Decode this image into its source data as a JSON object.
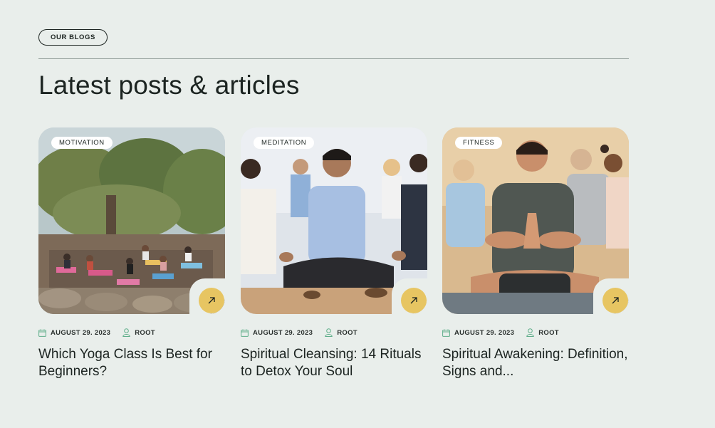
{
  "section": {
    "pill": "OUR BLOGS",
    "heading": "Latest posts & articles"
  },
  "colors": {
    "background": "#e9eeeb",
    "accent": "#e7c562",
    "icon": "#5fae8a",
    "text": "#1c2421"
  },
  "posts": [
    {
      "category": "MOTIVATION",
      "date": "AUGUST 29. 2023",
      "author": "ROOT",
      "title": "Which Yoga Class Is Best for Beginners?",
      "image": "outdoor-yoga-class-photo"
    },
    {
      "category": "MEDITATION",
      "date": "AUGUST 29. 2023",
      "author": "ROOT",
      "title": "Spiritual Cleansing: 14 Rituals to Detox Your Soul",
      "image": "meditating-man-photo"
    },
    {
      "category": "FITNESS",
      "date": "AUGUST 29. 2023",
      "author": "ROOT",
      "title": "Spiritual Awakening: Definition, Signs and...",
      "image": "prayer-pose-man-photo"
    }
  ]
}
